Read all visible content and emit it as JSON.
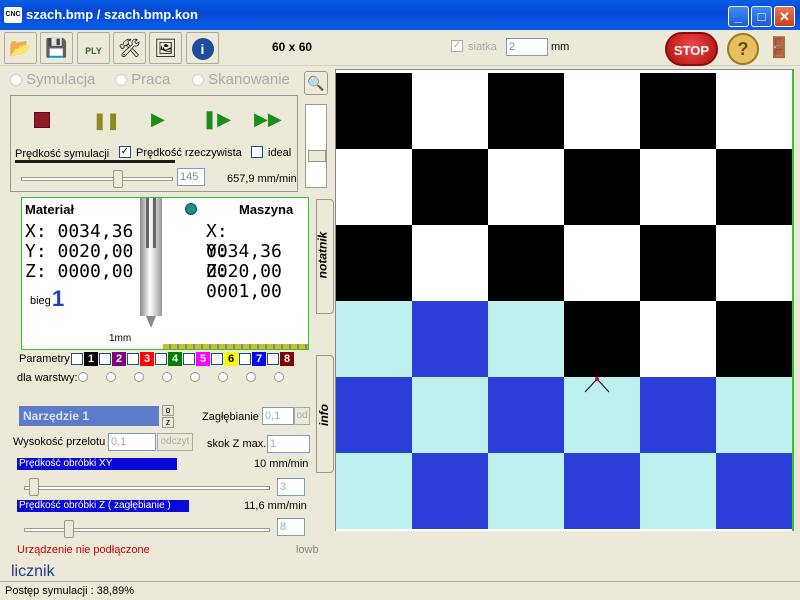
{
  "window": {
    "title": "szach.bmp  /  szach.bmp.kon",
    "app_icon_label": "CNC",
    "minimize": "_",
    "maximize": "□",
    "close": "✕"
  },
  "toolbar": {
    "grid_size": "60 x 60",
    "grid_label": "siatka",
    "grid_value": "2",
    "grid_unit": "mm",
    "stop_label": "STOP",
    "help_label": "?",
    "ply_label": "PLY",
    "info_label": "i"
  },
  "modes": {
    "simulation": "Symulacja",
    "work": "Praca",
    "scan": "Skanowanie"
  },
  "simulation": {
    "speed_label": "Prędkość symulacji",
    "real_speed_label": "Prędkość rzeczywista",
    "ideal_label": "ideal",
    "speed_value": "145",
    "speed_readout": "657,9 mm/min",
    "speed_fraction": 0.58
  },
  "positions": {
    "material_label": "Materiał",
    "machine_label": "Maszyna",
    "material": {
      "x": "X: 0034,36",
      "y": "Y: 0020,00",
      "z": "Z: 0000,00"
    },
    "machine": {
      "x": "X: 0034,36",
      "y": "Y: 0020,00",
      "z": "Z: 0001,00"
    },
    "gear_label": "bieg",
    "gear_value": "1",
    "scale_label": "1mm"
  },
  "layers": {
    "params_label": "Parametry",
    "for_layer_label": "dla warstwy:",
    "items": [
      {
        "num": "1",
        "color": "#000000"
      },
      {
        "num": "2",
        "color": "#800080"
      },
      {
        "num": "3",
        "color": "#FF0000"
      },
      {
        "num": "4",
        "color": "#008000"
      },
      {
        "num": "5",
        "color": "#FF00FF"
      },
      {
        "num": "6",
        "color": "#FFFF00"
      },
      {
        "num": "7",
        "color": "#0000FF"
      },
      {
        "num": "8",
        "color": "#800000"
      }
    ]
  },
  "tool": {
    "name": "Narzędzie 1",
    "o_label": "o",
    "z_label": "z",
    "depth_label": "Zagłębianie",
    "depth_value": "0,1",
    "depth_btn": "od",
    "travel_label": "Wysokość przelotu",
    "travel_value": "0,1",
    "travel_btn": "odczyt",
    "zmax_label": "skok Z max.",
    "zmax_value": "1",
    "xy_speed_label": "Prędkość obróbki XY",
    "xy_speed_value": "10 mm/min",
    "xy_speed_field": "3",
    "xy_speed_fraction": 0.02,
    "z_speed_label": "Prędkość obróbki Z  ( zagłębianie )",
    "z_speed_value": "11,6 mm/min",
    "z_speed_field": "8",
    "z_speed_fraction": 0.17
  },
  "status": {
    "device": "Urządzenie nie podłączone",
    "lowb": "lowb",
    "counter": "licznik",
    "progress": "Postęp symulacji : 38,89%"
  },
  "side_tabs": {
    "notes": "notatnik",
    "info": "info"
  },
  "canvas": {
    "colors": {
      "black": "#000000",
      "white": "#FFFFFF",
      "blue": "#2A3FD8",
      "cyan": "#BDF0EE"
    },
    "rows": [
      [
        "black",
        "white",
        "black",
        "white",
        "black",
        "white"
      ],
      [
        "white",
        "black",
        "white",
        "black",
        "white",
        "black"
      ],
      [
        "black",
        "white",
        "black",
        "white",
        "black",
        "white"
      ],
      [
        "cyan",
        "blue",
        "cyan",
        "black",
        "white",
        "black"
      ],
      [
        "blue",
        "cyan",
        "blue",
        "cyan",
        "blue",
        "cyan"
      ],
      [
        "cyan",
        "blue",
        "cyan",
        "blue",
        "cyan",
        "blue"
      ]
    ]
  }
}
